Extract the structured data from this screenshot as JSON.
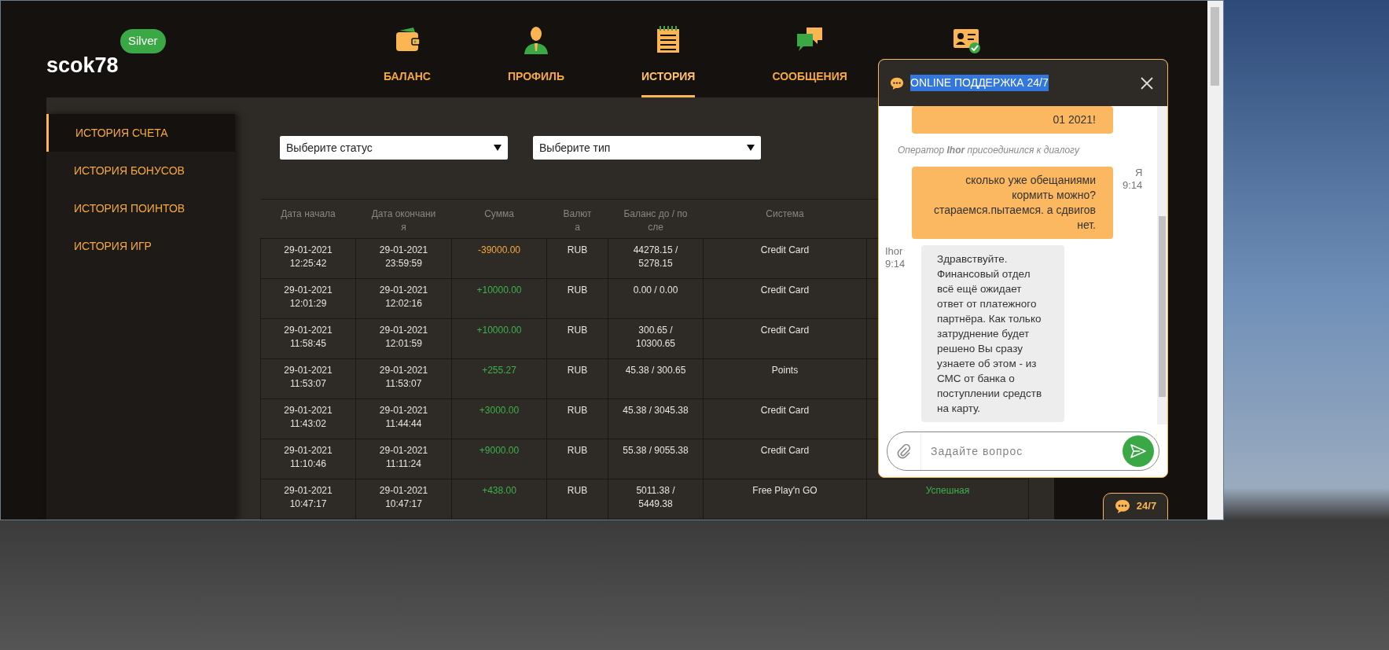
{
  "user": {
    "name": "scok78",
    "level": "Silver"
  },
  "nav": [
    {
      "label": "БАЛАНС",
      "selected": false
    },
    {
      "label": "ПРОФИЛЬ",
      "selected": false
    },
    {
      "label": "ИСТОРИЯ",
      "selected": true
    },
    {
      "label": "СООБЩЕНИЯ",
      "selected": false
    },
    {
      "selected": false
    }
  ],
  "sidebar": [
    {
      "label": "ИСТОРИЯ СЧЕТА",
      "selected": true
    },
    {
      "label": "ИСТОРИЯ БОНУСОВ",
      "selected": false
    },
    {
      "label": "ИСТОРИЯ ПОИНТОВ",
      "selected": false
    },
    {
      "label": "ИСТОРИЯ ИГР",
      "selected": false
    }
  ],
  "filters": [
    {
      "value": "Выберите статус"
    },
    {
      "value": "Выберите тип"
    }
  ],
  "table": {
    "columns": [
      "Дата начала",
      "Дата окончания",
      "Сумма",
      "Валюта",
      "Баланс до / после",
      "Система"
    ],
    "rows": [
      {
        "start": "29-01-2021 12:25:42",
        "end": "29-01-2021 23:59:59",
        "amount": "-39000.00",
        "kind": "debit",
        "currency": "RUB",
        "balance": "44278.15 / 5278.15",
        "system": "Credit Card"
      },
      {
        "start": "29-01-2021 12:01:29",
        "end": "29-01-2021 12:02:16",
        "amount": "+10000.00",
        "kind": "credit",
        "currency": "RUB",
        "balance": "0.00 / 0.00",
        "system": "Credit Card"
      },
      {
        "start": "29-01-2021 11:58:45",
        "end": "29-01-2021 12:01:59",
        "amount": "+10000.00",
        "kind": "credit",
        "currency": "RUB",
        "balance": "300.65 / 10300.65",
        "system": "Credit Card"
      },
      {
        "start": "29-01-2021 11:53:07",
        "end": "29-01-2021 11:53:07",
        "amount": "+255.27",
        "kind": "credit",
        "currency": "RUB",
        "balance": "45.38 / 300.65",
        "system": "Points"
      },
      {
        "start": "29-01-2021 11:43:02",
        "end": "29-01-2021 11:44:44",
        "amount": "+3000.00",
        "kind": "credit",
        "currency": "RUB",
        "balance": "45.38 / 3045.38",
        "system": "Credit Card"
      },
      {
        "start": "29-01-2021 11:10:46",
        "end": "29-01-2021 11:11:24",
        "amount": "+9000.00",
        "kind": "credit",
        "currency": "RUB",
        "balance": "55.38 / 9055.38",
        "system": "Credit Card"
      },
      {
        "start": "29-01-2021 10:47:17",
        "end": "29-01-2021 10:47:17",
        "amount": "+438.00",
        "kind": "credit",
        "currency": "RUB",
        "balance": "5011.38 / 5449.38",
        "system": "Free Play'n GO",
        "status": "Успешная"
      }
    ]
  },
  "chat": {
    "title": "ONLINE ПОДДЕРЖКА 24/7",
    "title_highlighted": true,
    "messages": [
      {
        "kind": "user",
        "text": "01 2021!"
      },
      {
        "kind": "system",
        "text": "Оператор **Ihor** присоединился к диалогу"
      },
      {
        "kind": "user",
        "author": "Я",
        "time": "9:14",
        "text": "сколько уже обещаниями кормить можно? стараемся.пытаемся. а сдвигов нет."
      },
      {
        "kind": "operator",
        "author": "Ihor",
        "time": "9:14",
        "text": "Здравствуйте. Финансовый отдел всё ещё ожидает ответ от платежного партнёра. Как только затруднение будет решено Вы сразу узнаете об этом - из СМС от банка о поступлении средств на карту."
      }
    ],
    "input": {
      "placeholder": "Задайте вопрос"
    }
  },
  "launcher": {
    "label": "24/7"
  }
}
